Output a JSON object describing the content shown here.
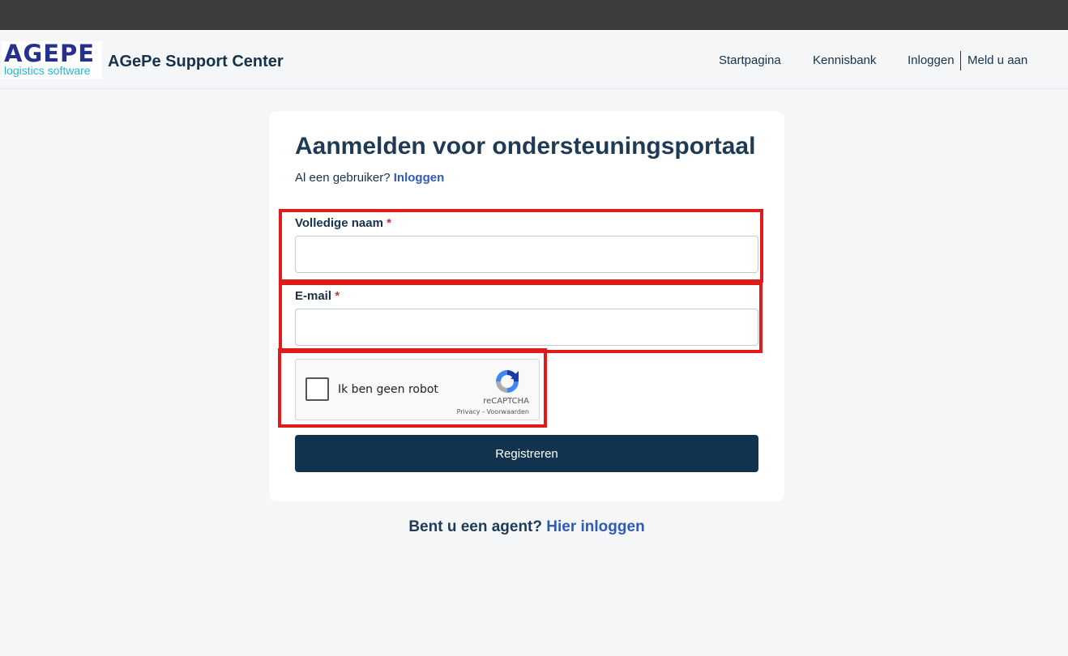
{
  "header": {
    "logo_main": "AGEPE",
    "logo_sub": "logistics software",
    "brand": "AGePe Support Center",
    "nav": {
      "start": "Startpagina",
      "kb": "Kennisbank",
      "login": "Inloggen",
      "signup": "Meld u aan"
    }
  },
  "form": {
    "title": "Aanmelden voor ondersteuningsportaal",
    "subtitle_prefix": "Al een gebruiker?",
    "subtitle_link": "Inloggen",
    "name_label": "Volledige naam",
    "name_value": "",
    "email_label": "E-mail",
    "email_value": "",
    "required_mark": "*",
    "captcha_label": "Ik ben geen robot",
    "captcha_brand": "reCAPTCHA",
    "captcha_links": "Privacy - Voorwaarden",
    "submit_label": "Registreren"
  },
  "footer": {
    "agent_prefix": "Bent u een agent?",
    "agent_link": "Hier inloggen"
  },
  "colors": {
    "primary": "#12334d",
    "link": "#2f5bb7",
    "highlight": "#e01b1b",
    "required": "#c0392b"
  }
}
